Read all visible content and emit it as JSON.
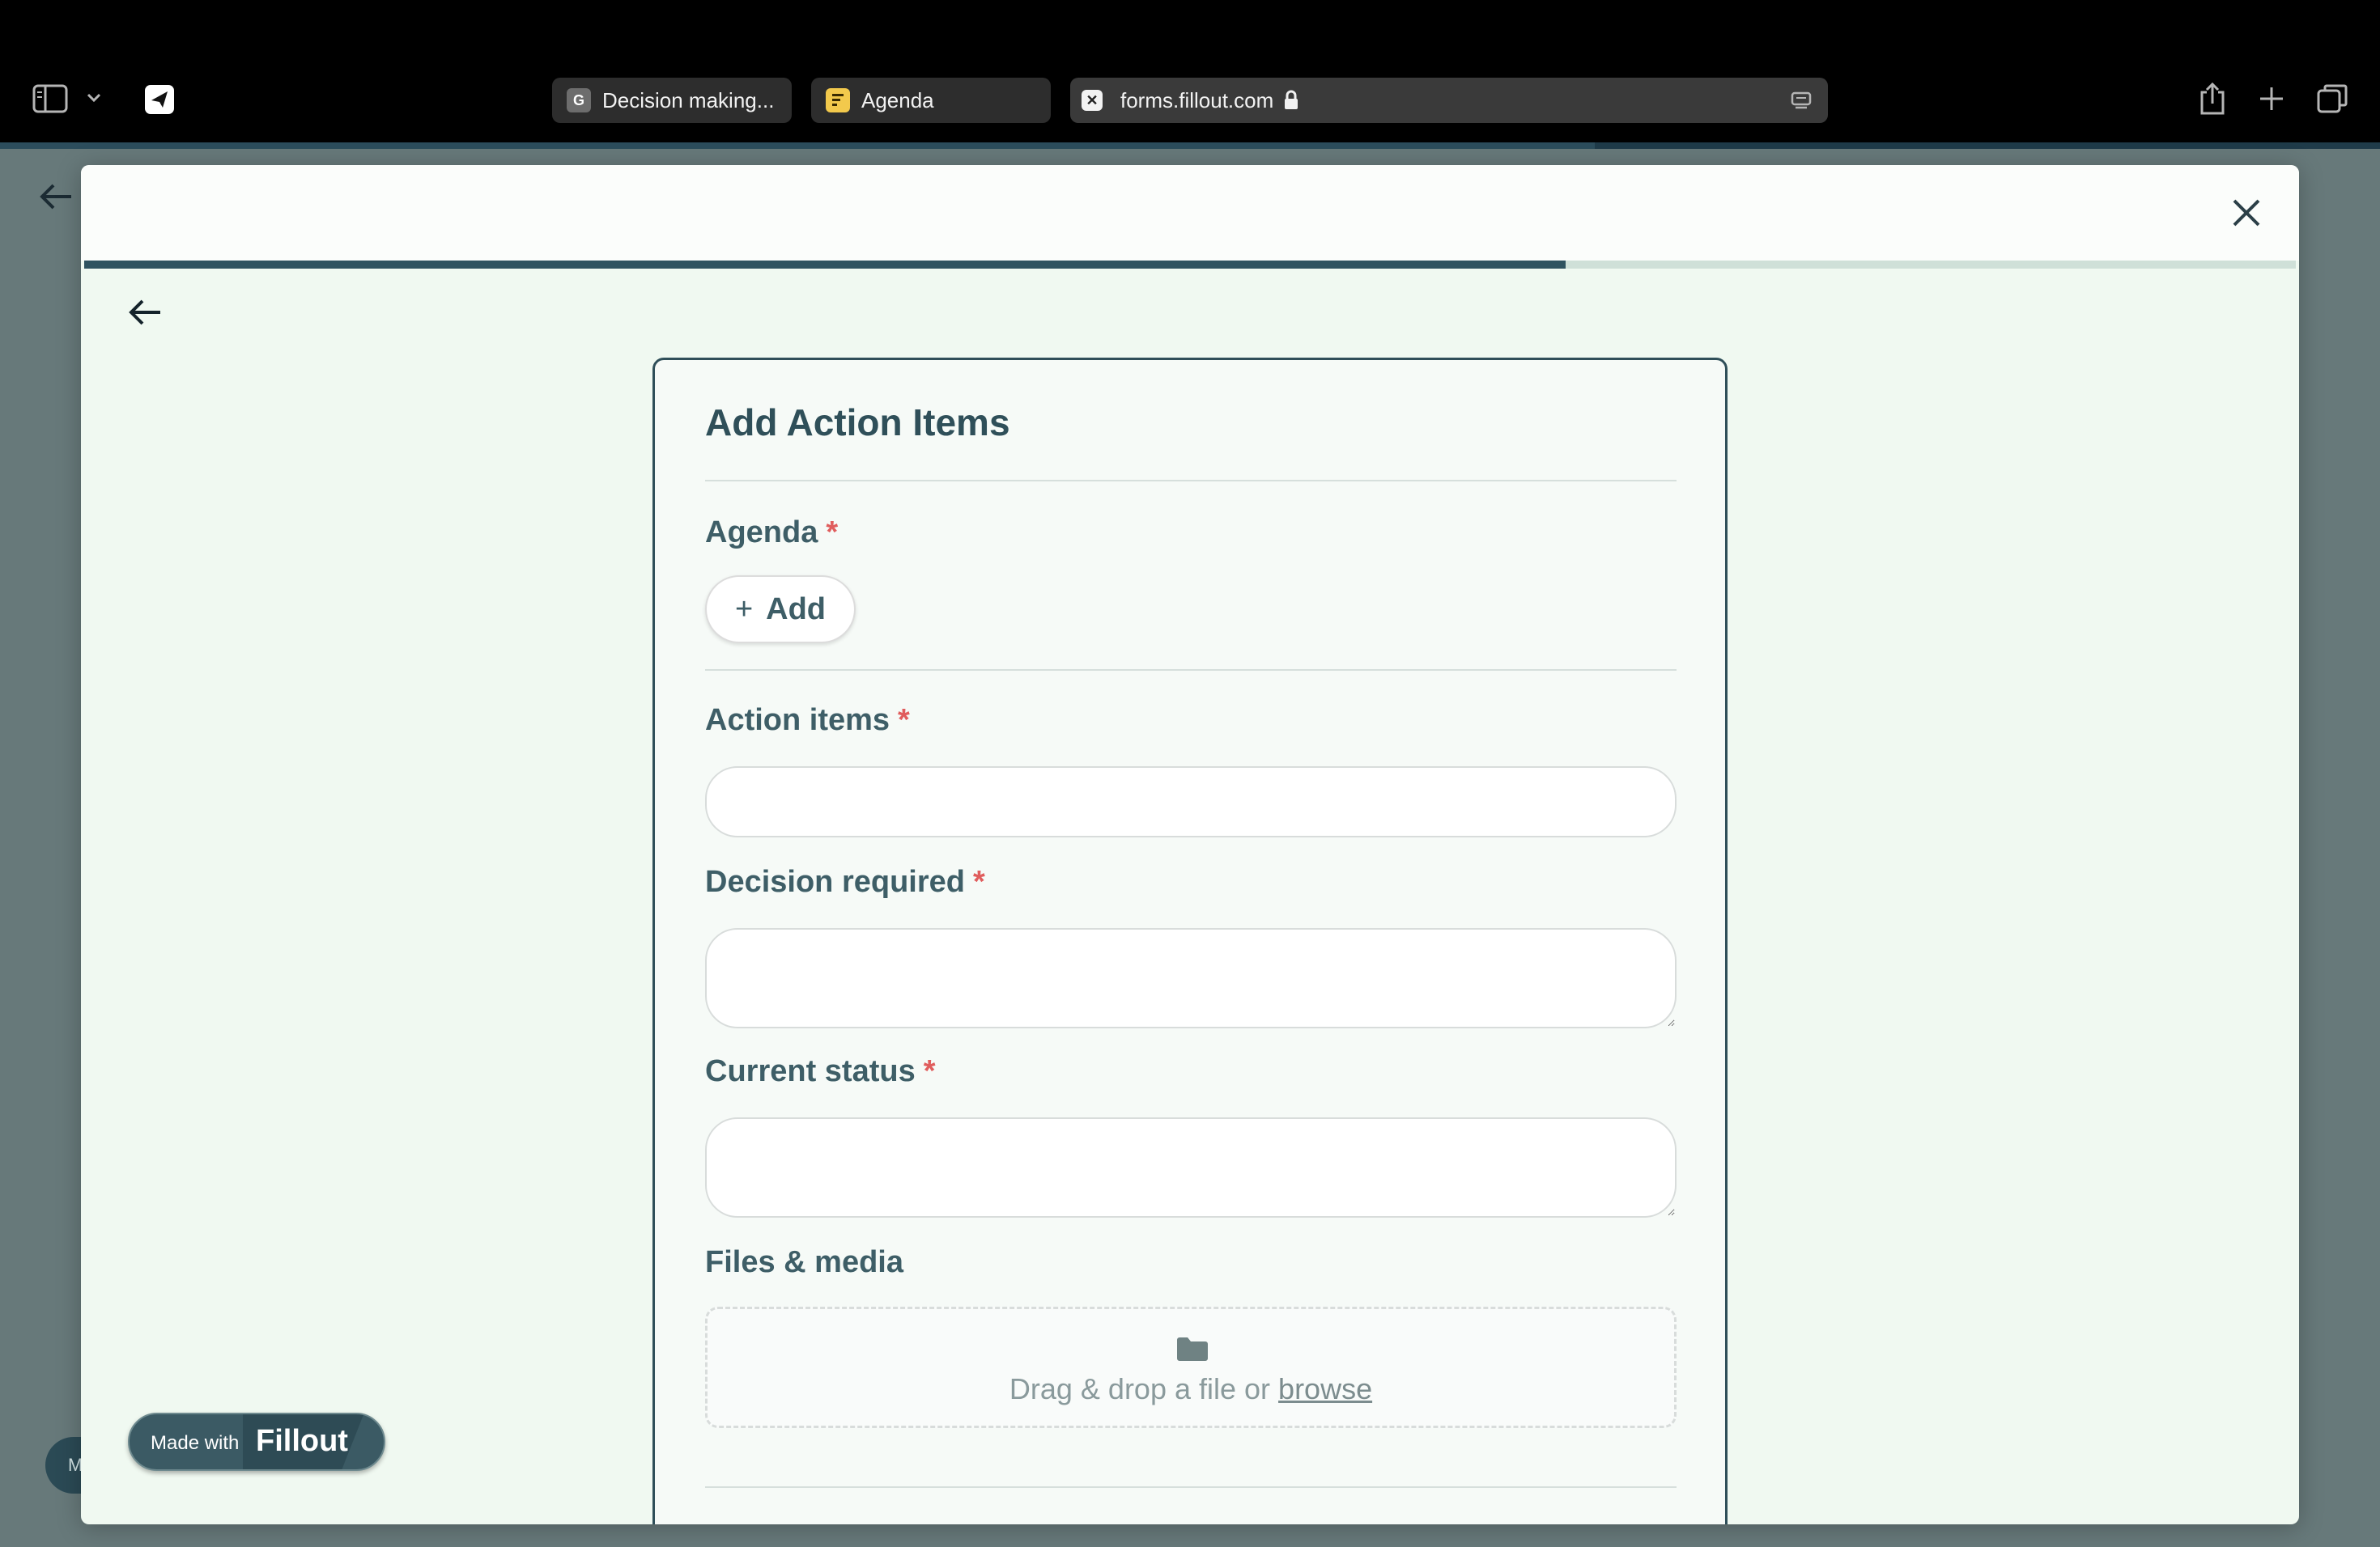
{
  "browser": {
    "tabs": [
      {
        "favicon": "G",
        "label": "Decision making..."
      },
      {
        "favicon": "agenda-doc-icon",
        "label": "Agenda"
      },
      {
        "favicon": "x-icon",
        "label": "forms.fillout.com"
      }
    ],
    "page_load_progress": 0.67
  },
  "form": {
    "progress": 0.67,
    "title": "Add Action Items",
    "agenda_label": "Agenda",
    "required_mark": "*",
    "add_label": "Add",
    "action_items_label": "Action items",
    "decision_required_label": "Decision required",
    "current_status_label": "Current status",
    "files_label": "Files & media",
    "dropzone_text": "Drag & drop a file or",
    "dropzone_browse": "browse"
  },
  "badge": {
    "made_with": "Made with",
    "brand": "Fillout"
  },
  "background": {
    "chip_text": "M"
  },
  "colors": {
    "accent": "#2f4f59",
    "required": "#e05d5d",
    "modal_bg": "#f0f9f1"
  }
}
